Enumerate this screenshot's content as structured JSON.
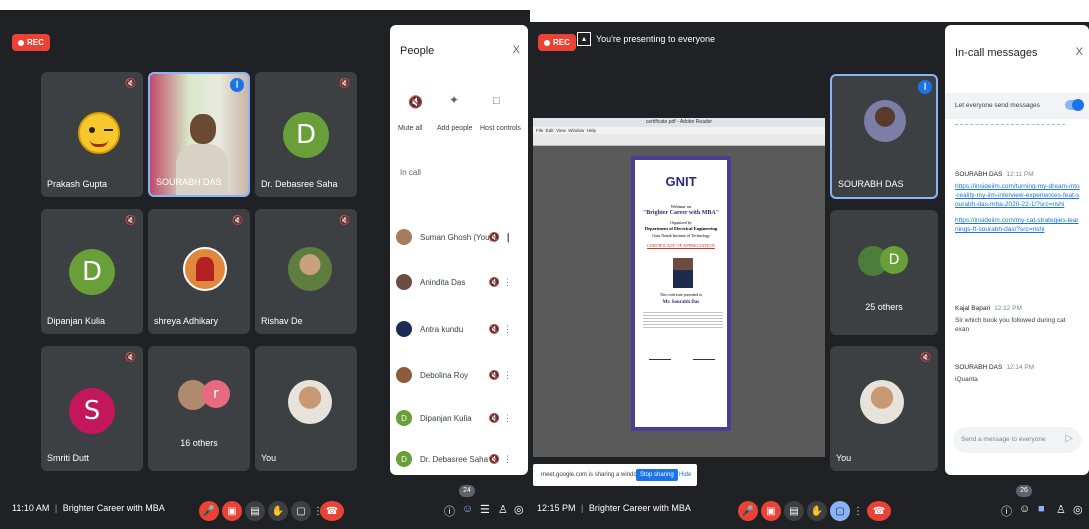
{
  "left": {
    "rec_label": "REC",
    "tiles": [
      {
        "name": "Prakash Gupta"
      },
      {
        "name": "SOURABH DAS"
      },
      {
        "name": "Dr. Debasree Saha",
        "initial": "D"
      },
      {
        "name": "Dipanjan Kulia",
        "initial": "D"
      },
      {
        "name": "shreya Adhikary"
      },
      {
        "name": "Rishav De"
      },
      {
        "name": "Smriti Dutt",
        "initial": "S"
      },
      {
        "name": "16 others",
        "initial": "r"
      },
      {
        "name": "You"
      }
    ],
    "people_panel": {
      "title": "People",
      "close": "X",
      "actions": [
        "Mute all",
        "Add people",
        "Host controls"
      ],
      "section": "In call",
      "participants": [
        {
          "name": "Suman Ghosh (You)"
        },
        {
          "name": "Anindita Das"
        },
        {
          "name": "Antra kundu"
        },
        {
          "name": "Debolina Roy"
        },
        {
          "name": "Dipanjan Kulia",
          "initial": "D"
        },
        {
          "name": "Dr. Debasree Saha",
          "initial": "D"
        }
      ]
    },
    "bottom": {
      "time": "11:10 AM",
      "separator": "|",
      "meeting": "Brighter Career with MBA",
      "people_count": "24"
    }
  },
  "right": {
    "rec_label": "REC",
    "presenting": "You're presenting to everyone",
    "tiles": [
      {
        "name": "SOURABH DAS"
      },
      {
        "name": "25 others",
        "initial": "D"
      },
      {
        "name": "You"
      }
    ],
    "document": {
      "title_bar": "certificate.pdf - Adobe Reader",
      "menu": [
        "File",
        "Edit",
        "View",
        "Window",
        "Help"
      ],
      "cert": {
        "logo": "GNIT",
        "intro": "Webinar on",
        "event": "\"Brighter Career with MBA\"",
        "organized": "Organized by",
        "dept": "Department of Electrical Engineering",
        "inst": "Guru Nanak Institute of Technology",
        "heading": "CERTIFICATE OF APPRECIATION",
        "presented": "This certificate presented to",
        "recipient": "Mr. Sourabh Das"
      }
    },
    "sharing_bar": {
      "text": "meet.google.com is sharing a window.",
      "stop": "Stop sharing",
      "hide": "Hide"
    },
    "messages_panel": {
      "title": "In-call messages",
      "close": "X",
      "toggle_label": "Let everyone send messages",
      "messages": [
        {
          "sender": "SOURABH DAS",
          "time": "12:11 PM",
          "link1": "https://insideiim.com/turning-my-dream-into-reality-my-iim-interview-experiences-feat-sourabh-das-mba-2020-22-1/?src=rishi",
          "link2": "https://insideiim.com/my-cat-strategies-learnings-ft-sourabh-das/?src=rishi"
        },
        {
          "sender": "Kajal Bapari",
          "time": "12:12 PM",
          "text": "Sir which book you followed during cat exan"
        },
        {
          "sender": "SOURABH DAS",
          "time": "12:14 PM",
          "text": "iQuanta"
        }
      ],
      "input_placeholder": "Send a message to everyone"
    },
    "bottom": {
      "time": "12:15 PM",
      "separator": "|",
      "meeting": "Brighter Career with MBA",
      "people_count": "26"
    }
  }
}
